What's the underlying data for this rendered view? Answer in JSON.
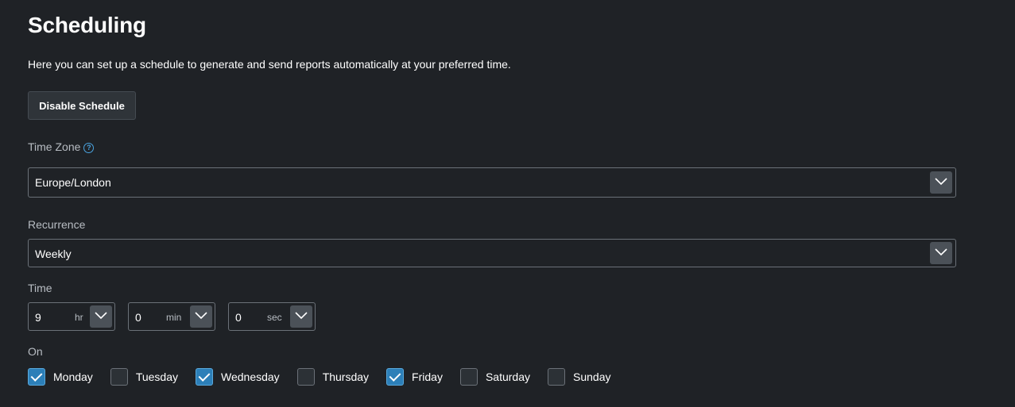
{
  "page": {
    "title": "Scheduling",
    "description": "Here you can set up a schedule to generate and send reports automatically at your preferred time."
  },
  "disable_button": {
    "label": "Disable Schedule"
  },
  "timezone": {
    "label": "Time Zone",
    "value": "Europe/London"
  },
  "recurrence": {
    "label": "Recurrence",
    "value": "Weekly"
  },
  "time": {
    "label": "Time",
    "hours": {
      "value": "9",
      "unit": "hr"
    },
    "minutes": {
      "value": "0",
      "unit": "min"
    },
    "seconds": {
      "value": "0",
      "unit": "sec"
    }
  },
  "on": {
    "label": "On",
    "days": [
      {
        "label": "Monday",
        "checked": true
      },
      {
        "label": "Tuesday",
        "checked": false
      },
      {
        "label": "Wednesday",
        "checked": true
      },
      {
        "label": "Thursday",
        "checked": false
      },
      {
        "label": "Friday",
        "checked": true
      },
      {
        "label": "Saturday",
        "checked": false
      },
      {
        "label": "Sunday",
        "checked": false
      }
    ]
  },
  "colors": {
    "background": "#1f2226",
    "accent": "#2c7fb8",
    "help_icon": "#4aa3df"
  }
}
